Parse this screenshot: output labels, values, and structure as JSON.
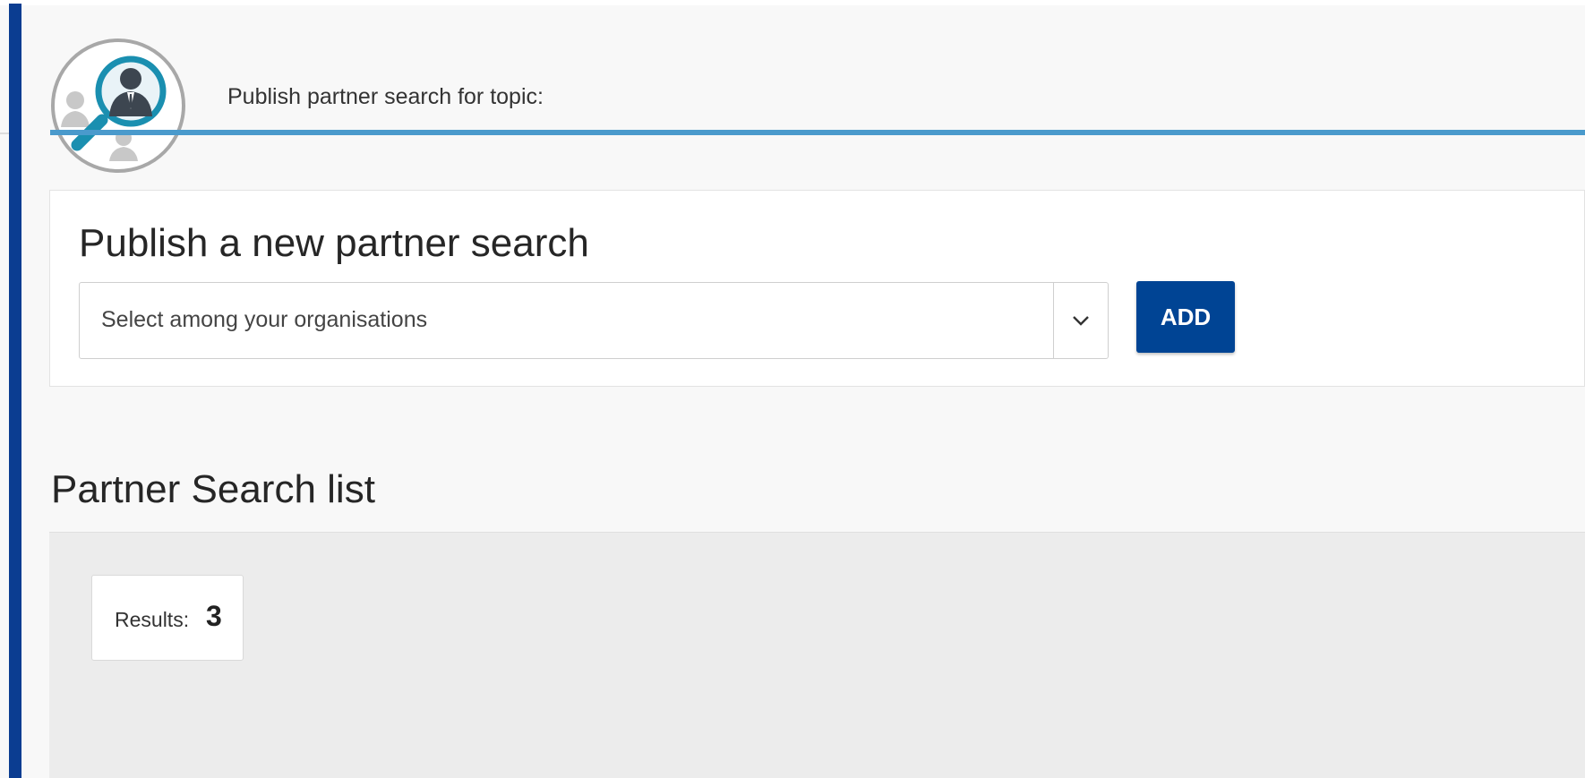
{
  "header": {
    "title": "Publish partner search for topic:",
    "icon": "partner-search-icon",
    "rule_color": "#4a9acc"
  },
  "publish_card": {
    "title": "Publish a new partner search",
    "organisation_select": {
      "placeholder": "Select among your organisations",
      "icon": "chevron-down-icon"
    },
    "add_label": "ADD",
    "add_color": "#004494"
  },
  "partner_list": {
    "title": "Partner Search list",
    "results_label": "Results:",
    "results_count": "3"
  },
  "colors": {
    "left_accent": "#0b3d91",
    "page_background": "#f8f8f8",
    "list_panel_background": "#ececec"
  }
}
